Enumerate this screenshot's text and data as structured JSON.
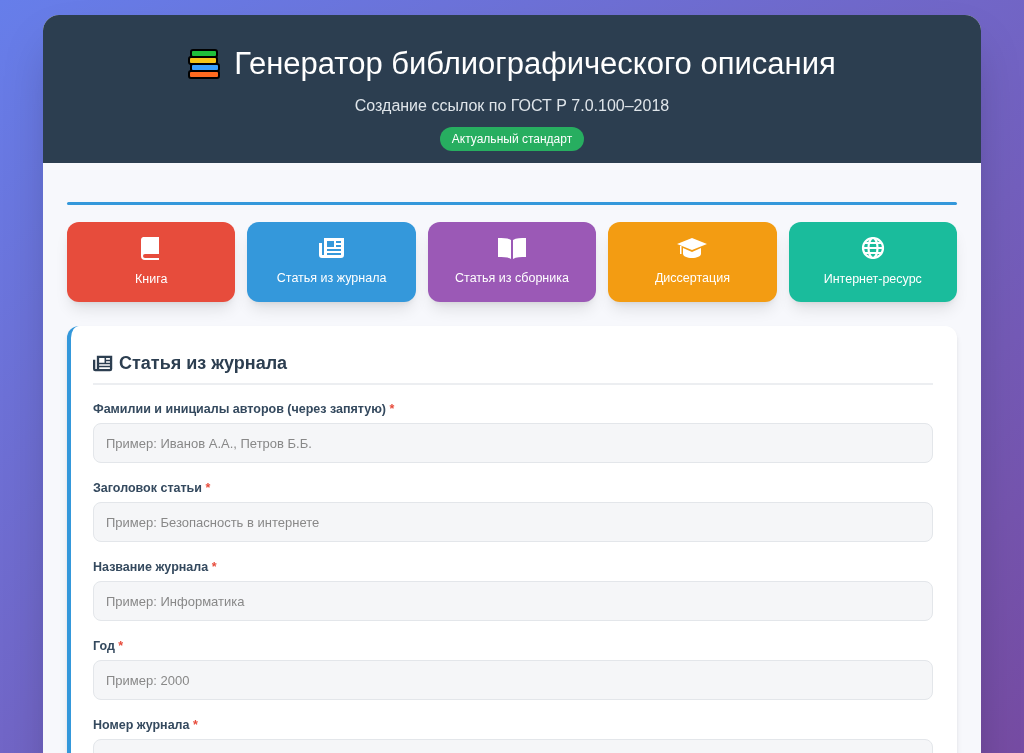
{
  "header": {
    "title": "Генератор библиографического описания",
    "subtitle": "Создание ссылок по ГОСТ Р 7.0.100–2018",
    "badge": "Актуальный стандарт"
  },
  "source_types": [
    {
      "kind": "book",
      "label": "Книга",
      "color": "#e74c3c"
    },
    {
      "kind": "journal",
      "label": "Статья из журнала",
      "color": "#3498db"
    },
    {
      "kind": "collection",
      "label": "Статья из сборника",
      "color": "#9b59b6"
    },
    {
      "kind": "thesis",
      "label": "Диссертация",
      "color": "#f39c12"
    },
    {
      "kind": "web",
      "label": "Интернет-ресурс",
      "color": "#1abc9c"
    }
  ],
  "form": {
    "title": "Статья из журнала",
    "fields": [
      {
        "label": "Фамилии и инициалы авторов (через запятую)",
        "required_mark": "*",
        "placeholder": "Пример: Иванов А.А., Петров Б.Б."
      },
      {
        "label": "Заголовок статьи",
        "required_mark": "*",
        "placeholder": "Пример: Безопасность в интернете"
      },
      {
        "label": "Название журнала",
        "required_mark": "*",
        "placeholder": "Пример: Информатика"
      },
      {
        "label": "Год",
        "required_mark": "*",
        "placeholder": "Пример: 2000"
      },
      {
        "label": "Номер журнала",
        "required_mark": "*"
      }
    ]
  }
}
